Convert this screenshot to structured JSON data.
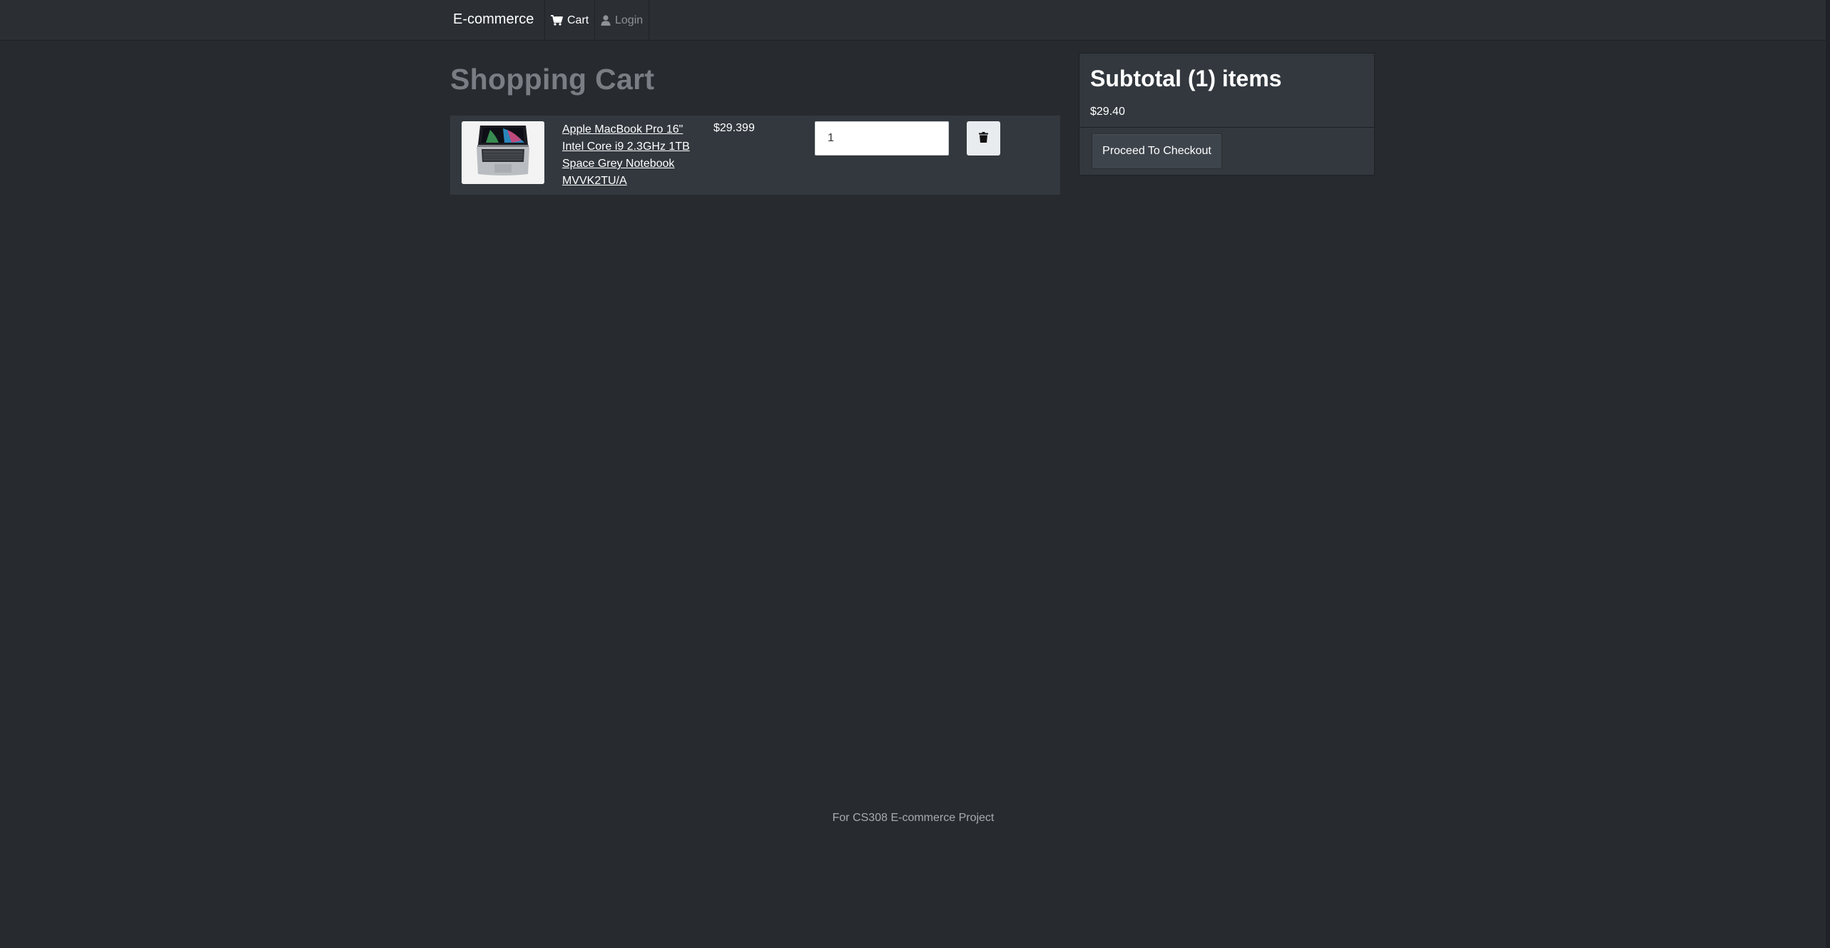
{
  "navbar": {
    "brand": "E-commerce",
    "cart_label": "Cart",
    "login_label": "Login",
    "cart_icon": "cart-icon",
    "login_icon": "user-icon"
  },
  "main": {
    "title": "Shopping Cart",
    "cart_items": [
      {
        "name": "Apple MacBook Pro 16\" Intel Core i9 2.3GHz 1TB Space Grey Notebook MVVK2TU/A",
        "price": "$29.399",
        "quantity": "1",
        "thumbnail_icon": "laptop-icon",
        "delete_icon": "trash-icon"
      }
    ]
  },
  "summary": {
    "title": "Subtotal (1) items",
    "amount": "$29.40",
    "checkout_label": "Proceed To Checkout"
  },
  "footer": {
    "text": "For CS308 E-commerce Project"
  },
  "colors": {
    "background": "#272b30",
    "navbar": "#2b2f34",
    "row_background": "#32383e",
    "title_color": "#7a7e84"
  }
}
